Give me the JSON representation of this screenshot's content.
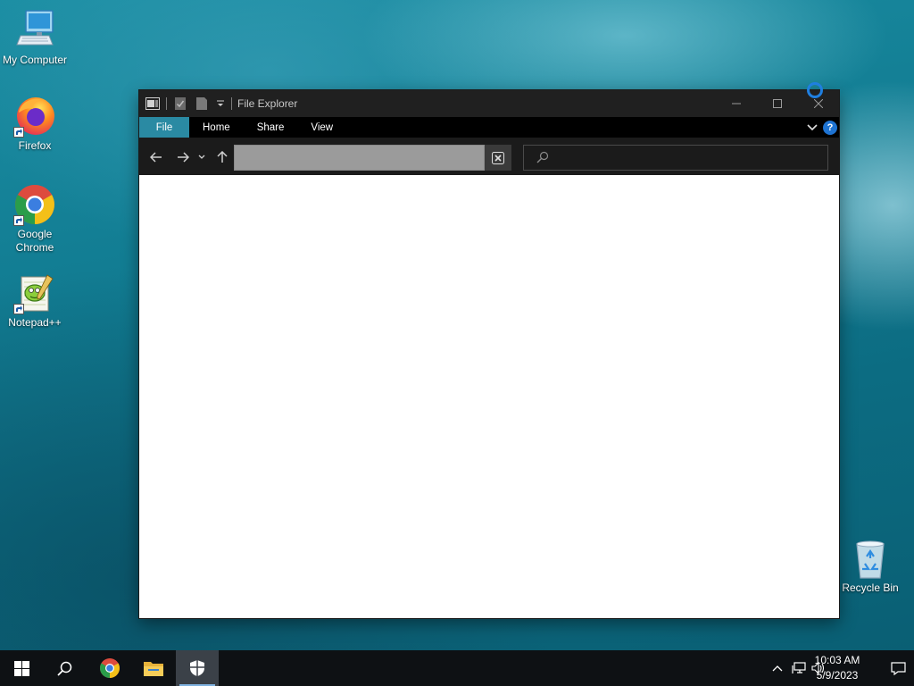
{
  "desktop": {
    "icons": [
      {
        "label_lines": [
          "My Computer"
        ]
      },
      {
        "label_lines": [
          "Firefox"
        ]
      },
      {
        "label_lines": [
          "Google",
          "Chrome"
        ]
      },
      {
        "label_lines": [
          "Notepad++"
        ]
      },
      {
        "label_lines": [
          "Recycle Bin"
        ]
      }
    ]
  },
  "window": {
    "title": "File Explorer",
    "ribbon_tabs": [
      "File",
      "Home",
      "Share",
      "View"
    ],
    "active_tab": "File",
    "address_value": "",
    "search_placeholder": ""
  },
  "taskbar": {
    "pinned": [
      "start",
      "search",
      "chrome",
      "file-explorer",
      "windows-security"
    ],
    "active": "windows-security"
  },
  "clock": {
    "time": "10:03 AM",
    "date": "5/9/2023"
  },
  "colors": {
    "accent": "#2a8aa3",
    "taskbar": "#0e1114",
    "titlebar": "#202020"
  }
}
